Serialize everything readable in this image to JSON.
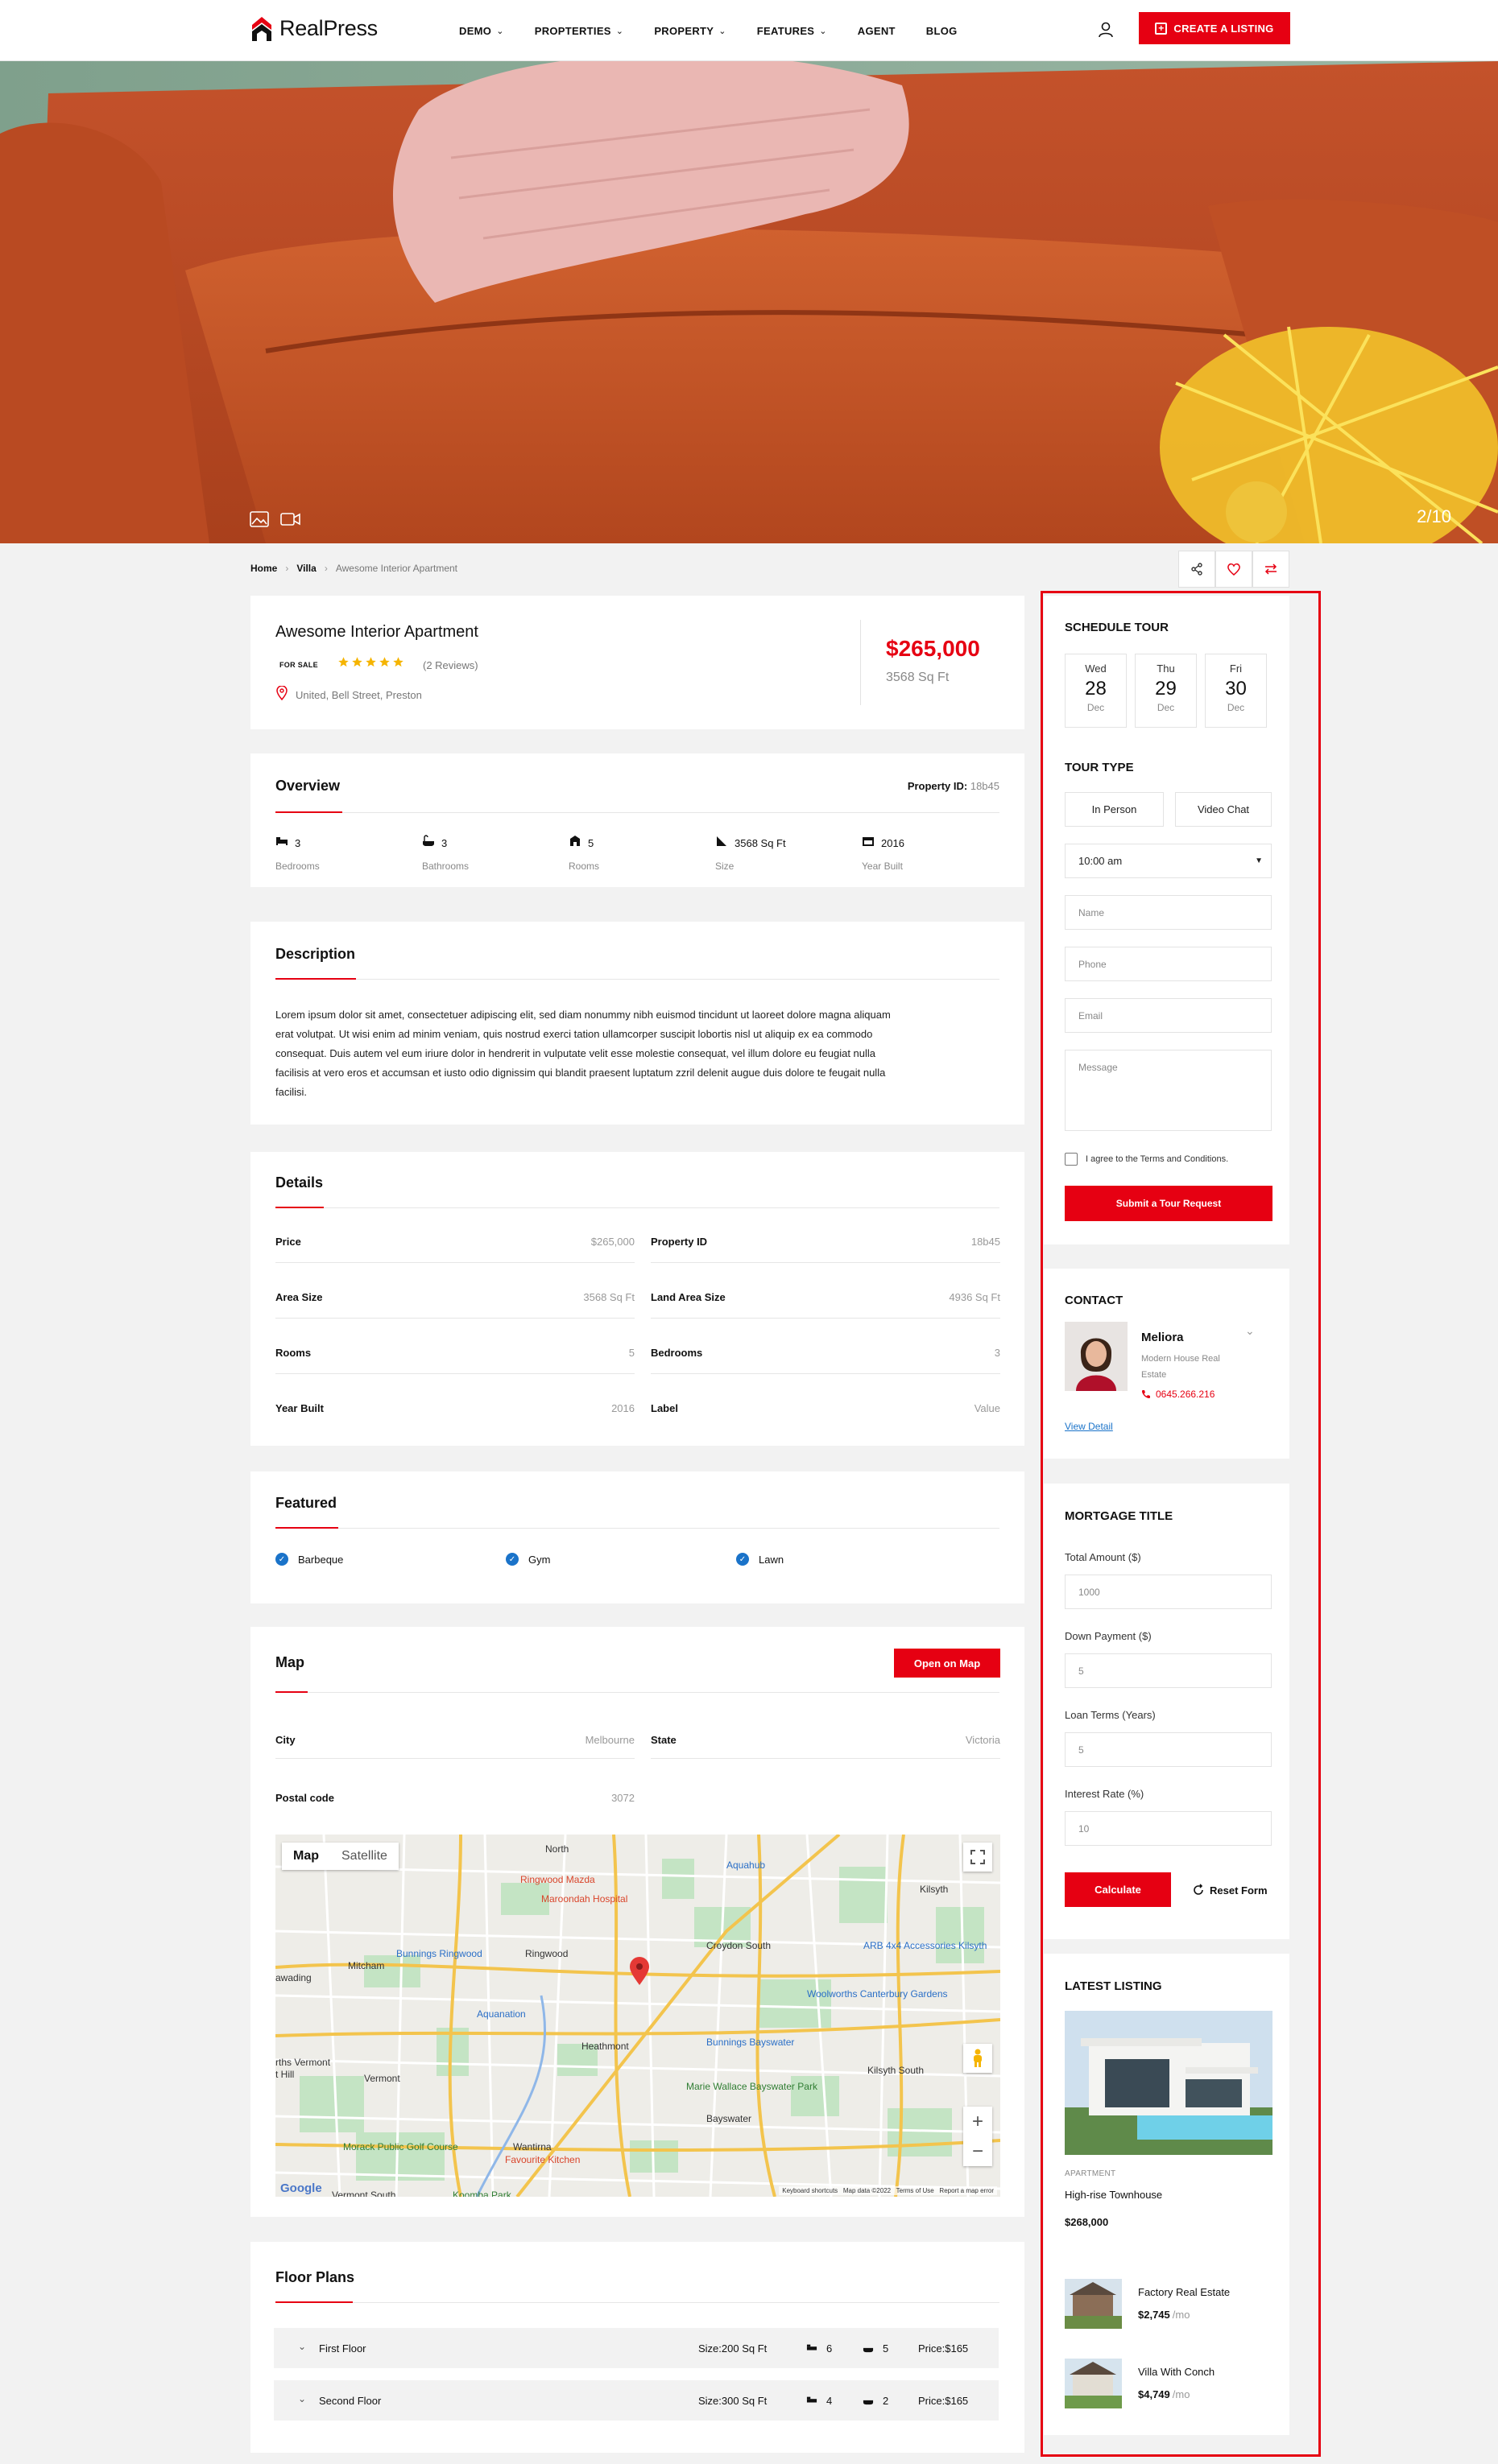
{
  "header": {
    "logo_text": "RealPress",
    "nav": [
      {
        "label": "DEMO",
        "dropdown": true
      },
      {
        "label": "PROPTERTIES",
        "dropdown": true
      },
      {
        "label": "PROPERTY",
        "dropdown": true
      },
      {
        "label": "FEATURES",
        "dropdown": true
      },
      {
        "label": "AGENT",
        "dropdown": false
      },
      {
        "label": "BLOG",
        "dropdown": false
      }
    ],
    "create_label": "CREATE A LISTING"
  },
  "hero": {
    "counter": "2/10"
  },
  "breadcrumb": {
    "home": "Home",
    "category": "Villa",
    "current": "Awesome Interior Apartment"
  },
  "listing": {
    "title": "Awesome Interior Apartment",
    "status": "FOR SALE",
    "reviews": "(2 Reviews)",
    "rating": 5,
    "address": "United, Bell Street, Preston",
    "price": "$265,000",
    "size": "3568 Sq Ft"
  },
  "overview": {
    "title": "Overview",
    "property_id_label": "Property ID:",
    "property_id": "18b45",
    "stats": [
      {
        "icon": "bed-icon",
        "value": "3",
        "label": "Bedrooms"
      },
      {
        "icon": "bath-icon",
        "value": "3",
        "label": "Bathrooms"
      },
      {
        "icon": "room-icon",
        "value": "5",
        "label": "Rooms"
      },
      {
        "icon": "size-icon",
        "value": "3568 Sq Ft",
        "label": "Size"
      },
      {
        "icon": "calendar-icon",
        "value": "2016",
        "label": "Year Built"
      }
    ]
  },
  "description": {
    "title": "Description",
    "lines": [
      "Lorem ipsum dolor sit amet, consectetuer adipiscing elit, sed diam nonummy nibh euismod tincidunt ut laoreet dolore magna aliquam",
      "erat volutpat. Ut wisi enim ad minim veniam, quis nostrud exerci tation ullamcorper suscipit lobortis nisl ut aliquip ex ea commodo",
      "consequat. Duis autem vel eum iriure dolor in hendrerit in vulputate velit esse molestie consequat, vel illum dolore eu feugiat nulla",
      "facilisis at vero eros et accumsan et iusto odio dignissim qui blandit praesent luptatum zzril delenit augue duis dolore te feugait nulla",
      "facilisi."
    ]
  },
  "details": {
    "title": "Details",
    "rows": [
      {
        "l_label": "Price",
        "l_value": "$265,000",
        "r_label": "Property ID",
        "r_value": "18b45"
      },
      {
        "l_label": "Area Size",
        "l_value": "3568 Sq Ft",
        "r_label": "Land Area Size",
        "r_value": "4936 Sq Ft"
      },
      {
        "l_label": "Rooms",
        "l_value": "5",
        "r_label": "Bedrooms",
        "r_value": "3"
      },
      {
        "l_label": "Year Built",
        "l_value": "2016",
        "r_label": "Label",
        "r_value": "Value"
      }
    ]
  },
  "featured": {
    "title": "Featured",
    "items": [
      "Barbeque",
      "Gym",
      "Lawn"
    ]
  },
  "map": {
    "title": "Map",
    "open_label": "Open on Map",
    "city_label": "City",
    "city": "Melbourne",
    "state_label": "State",
    "state": "Victoria",
    "postal_label": "Postal code",
    "postal": "3072",
    "tab_map": "Map",
    "tab_satellite": "Satellite",
    "places": [
      "North",
      "Ringwood Mazda",
      "Maroondah Hospital",
      "Aquahub",
      "Kilsyth",
      "Bunnings Ringwood",
      "Ringwood",
      "Croydon South",
      "ARB 4x4 Accessories Kilsyth",
      "Mitcham",
      "awading",
      "Aquanation",
      "Heathmont",
      "Woolworths Canterbury Gardens",
      "Bunnings Bayswater",
      "rths Vermont",
      "t Hill",
      "Vermont",
      "Marie Wallace Bayswater Park",
      "Kilsyth South",
      "Bayswater",
      "Morack Public Golf Course",
      "Wantirna",
      "Favourite Kitchen",
      "Vermont South",
      "Koomba Park"
    ],
    "footer": "Keyboard shortcuts   Map data ©2022   Terms of Use   Report a map error",
    "google": "Google"
  },
  "floor_plans": {
    "title": "Floor Plans",
    "rows": [
      {
        "name": "First Floor",
        "size": "Size:200 Sq Ft",
        "beds": "6",
        "baths": "5",
        "price": "Price:$165"
      },
      {
        "name": "Second Floor",
        "size": "Size:300 Sq Ft",
        "beds": "4",
        "baths": "2",
        "price": "Price:$165"
      }
    ]
  },
  "schedule": {
    "title": "SCHEDULE TOUR",
    "days": [
      {
        "dow": "Wed",
        "day": "28",
        "mon": "Dec"
      },
      {
        "dow": "Thu",
        "day": "29",
        "mon": "Dec"
      },
      {
        "dow": "Fri",
        "day": "30",
        "mon": "Dec"
      }
    ],
    "tour_type_title": "TOUR TYPE",
    "in_person": "In Person",
    "video_chat": "Video Chat",
    "time": "10:00 am",
    "name_ph": "Name",
    "phone_ph": "Phone",
    "email_ph": "Email",
    "message_ph": "Message",
    "agree": "I agree to the Terms and Conditions.",
    "submit": "Submit a Tour Request"
  },
  "contact": {
    "title": "CONTACT",
    "name": "Meliora",
    "company": "Modern House Real Estate",
    "phone": "0645.266.216",
    "view_detail": "View Detail"
  },
  "mortgage": {
    "title": "MORTGAGE TITLE",
    "total_label": "Total Amount ($)",
    "total": "1000",
    "down_label": "Down Payment ($)",
    "down": "5",
    "terms_label": "Loan Terms (Years)",
    "terms": "5",
    "rate_label": "Interest Rate (%)",
    "rate": "10",
    "calculate": "Calculate",
    "reset": "Reset Form"
  },
  "latest": {
    "title": "LATEST LISTING",
    "featured": {
      "category": "APARTMENT",
      "name": "High-rise Townhouse",
      "price": "$268,000"
    },
    "items": [
      {
        "name": "Factory Real Estate",
        "price": "$2,745",
        "per": "/mo"
      },
      {
        "name": "Villa With Conch",
        "price": "$4,749",
        "per": "/mo"
      }
    ]
  },
  "colors": {
    "accent": "#e60012",
    "check": "#1a73c9",
    "highlight_border": "#e60012"
  }
}
